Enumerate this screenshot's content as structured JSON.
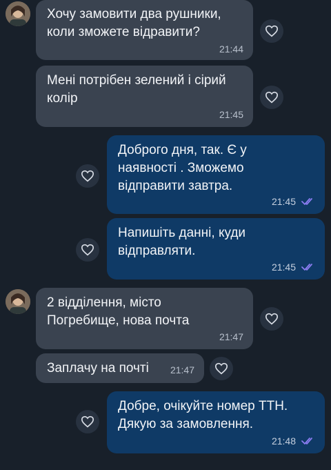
{
  "messages": [
    {
      "direction": "in",
      "text": "Хочу замовити два рушники,\nколи зможете відравити?",
      "time": "21:44"
    },
    {
      "direction": "in",
      "text": "Мені потрібен зелений і сірий\nколір",
      "time": "21:45"
    },
    {
      "direction": "out",
      "text": "Доброго дня, так. Є у\nнаявності . Зможемо\nвідправити завтра.",
      "time": "21:45"
    },
    {
      "direction": "out",
      "text": "Напишіть данні, куди\nвідправляти.",
      "time": "21:45"
    },
    {
      "direction": "in",
      "text": "2 відділення, місто\nПогребище, нова почта",
      "time": "21:47"
    },
    {
      "direction": "in",
      "text": "Заплачу на почті",
      "time": "21:47"
    },
    {
      "direction": "out",
      "text": "Добре, очікуйте номер ТТН.\nДякую за замовлення.",
      "time": "21:48"
    }
  ],
  "icons": {
    "avatar": "avatar",
    "react": "heart-icon",
    "read": "double-check-icon"
  },
  "colors": {
    "background": "#18202a",
    "incoming_bubble": "#3a4350",
    "outgoing_bubble": "#0f3a66",
    "read_ticks": "#8a7cf0"
  }
}
